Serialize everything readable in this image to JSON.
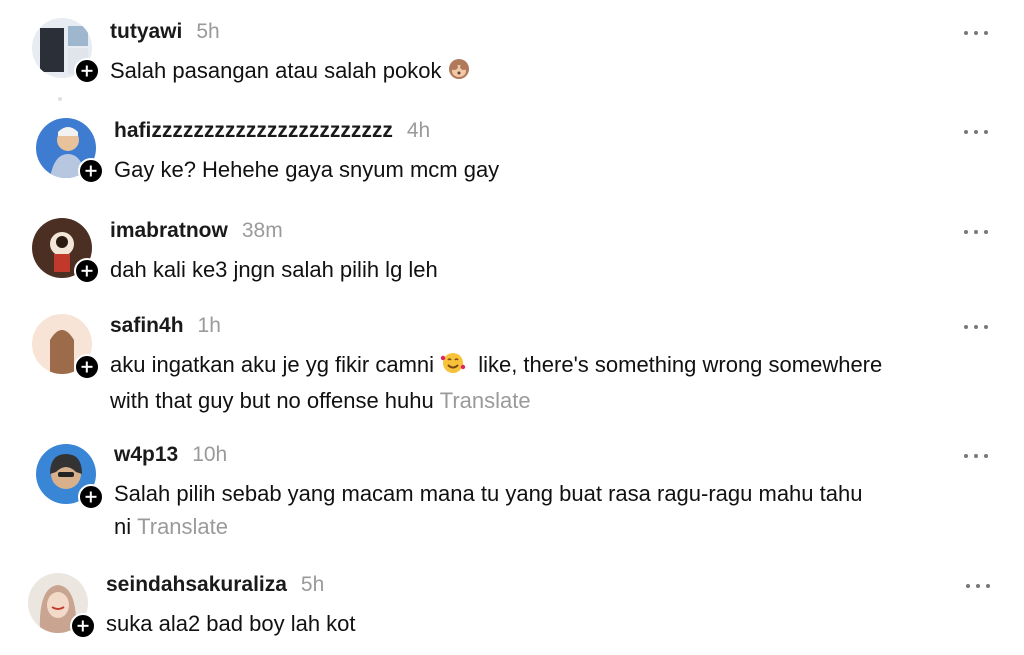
{
  "comments": [
    {
      "username": "tutyawi",
      "time": "5h",
      "lines": [
        "Salah pasangan atau salah pokok"
      ],
      "emoji": "see-no-evil-monkey-icon",
      "translate": "",
      "avatar_colors": [
        "#2a2f38",
        "#e8eef4"
      ]
    },
    {
      "username": "hafizzzzzzzzzzzzzzzzzzzzzzz",
      "time": "4h",
      "lines": [
        "Gay ke? Hehehe gaya snyum mcm gay"
      ],
      "translate": "",
      "avatar_colors": [
        "#3c78c8",
        "#e2b98f"
      ]
    },
    {
      "username": "imabratnow",
      "time": "38m",
      "lines": [
        "dah kali ke3 jngn salah pilih lg leh"
      ],
      "translate": "",
      "avatar_colors": [
        "#5a3a28",
        "#f4e6d8"
      ]
    },
    {
      "username": "safin4h",
      "time": "1h",
      "lines": [
        "aku ingatkan aku je yg fikir camni",
        "like, there's something wrong somewhere",
        "with that guy but no offense huhu"
      ],
      "emoji": "smiling-face-with-hearts-icon",
      "translate": "Translate",
      "avatar_colors": [
        "#f6d9c8",
        "#9b6b4a"
      ]
    },
    {
      "username": "w4p13",
      "time": "10h",
      "lines": [
        "Salah pilih sebab yang macam mana tu yang buat rasa ragu-ragu mahu tahu",
        "ni"
      ],
      "translate": "Translate",
      "avatar_colors": [
        "#3b86d6",
        "#3a3a3a"
      ]
    },
    {
      "username": "seindahsakuraliza",
      "time": "5h",
      "lines": [
        "suka ala2 bad boy lah kot"
      ],
      "translate": "",
      "avatar_colors": [
        "#e9e2dc",
        "#c9a895"
      ]
    }
  ]
}
